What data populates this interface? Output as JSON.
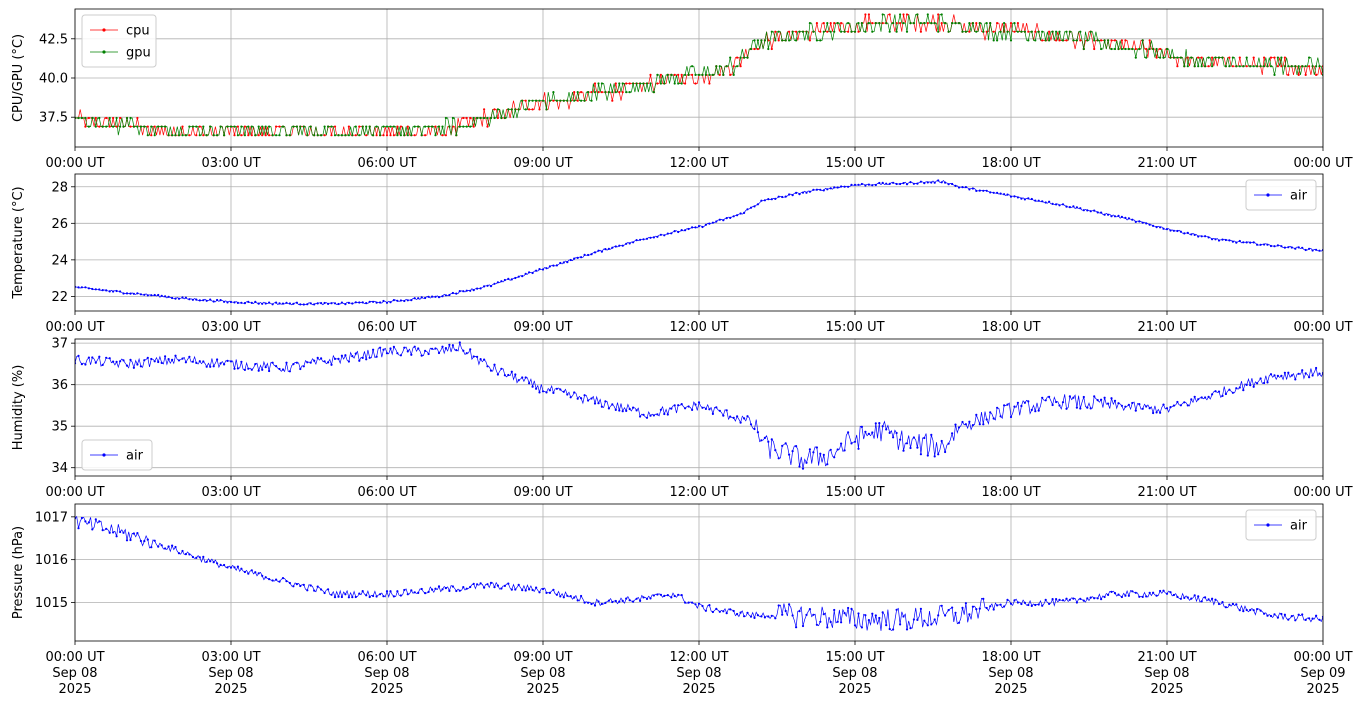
{
  "chart_data": [
    {
      "type": "line",
      "ylabel": "CPU/GPU (°C)",
      "xlabel": "",
      "ylim": [
        35.6,
        44.4
      ],
      "yticks": [
        37.5,
        40.0,
        42.5
      ],
      "ytick_labels": [
        "37.5",
        "40.0",
        "42.5"
      ],
      "xlim_hours": [
        0,
        24
      ],
      "xtick_labels": [
        "00:00 UT",
        "03:00 UT",
        "06:00 UT",
        "09:00 UT",
        "12:00 UT",
        "15:00 UT",
        "18:00 UT",
        "21:00 UT",
        "00:00 UT"
      ],
      "grid": true,
      "legend": "upper left",
      "series": [
        {
          "name": "cpu",
          "color": "#ff0000",
          "points": [
            [
              0,
              37.5
            ],
            [
              0.5,
              37.0
            ],
            [
              1,
              37.0
            ],
            [
              1.5,
              36.5
            ],
            [
              2,
              36.5
            ],
            [
              3,
              36.5
            ],
            [
              4,
              36.5
            ],
            [
              5,
              36.5
            ],
            [
              6,
              36.5
            ],
            [
              7,
              36.5
            ],
            [
              7.5,
              37.0
            ],
            [
              8,
              37.5
            ],
            [
              8.5,
              38.0
            ],
            [
              9,
              38.5
            ],
            [
              9.5,
              38.5
            ],
            [
              10,
              39.0
            ],
            [
              10.5,
              39.2
            ],
            [
              11,
              39.5
            ],
            [
              11.5,
              40.0
            ],
            [
              12,
              40.0
            ],
            [
              12.5,
              40.5
            ],
            [
              12.8,
              41.0
            ],
            [
              13,
              42.0
            ],
            [
              13.5,
              42.5
            ],
            [
              14,
              42.8
            ],
            [
              14.5,
              43.0
            ],
            [
              15,
              43.3
            ],
            [
              15.5,
              43.5
            ],
            [
              16,
              43.5
            ],
            [
              16.5,
              43.5
            ],
            [
              17,
              43.3
            ],
            [
              17.5,
              43.0
            ],
            [
              18,
              43.0
            ],
            [
              18.5,
              42.8
            ],
            [
              19,
              42.5
            ],
            [
              19.5,
              42.3
            ],
            [
              20,
              42.0
            ],
            [
              20.5,
              41.8
            ],
            [
              21,
              41.5
            ],
            [
              21.5,
              41.0
            ],
            [
              22,
              41.0
            ],
            [
              22.5,
              40.7
            ],
            [
              23,
              40.7
            ],
            [
              23.5,
              40.7
            ],
            [
              24,
              40.5
            ]
          ]
        },
        {
          "name": "gpu",
          "color": "#008000",
          "points": [
            [
              0,
              37.5
            ],
            [
              0.5,
              37.0
            ],
            [
              1,
              37.0
            ],
            [
              1.5,
              36.7
            ],
            [
              2,
              36.7
            ],
            [
              3,
              36.7
            ],
            [
              4,
              36.5
            ],
            [
              5,
              36.5
            ],
            [
              6,
              36.7
            ],
            [
              7,
              36.7
            ],
            [
              7.5,
              37.0
            ],
            [
              8,
              37.5
            ],
            [
              8.5,
              38.0
            ],
            [
              9,
              38.5
            ],
            [
              9.5,
              38.5
            ],
            [
              10,
              39.0
            ],
            [
              10.5,
              39.2
            ],
            [
              11,
              39.5
            ],
            [
              11.5,
              40.0
            ],
            [
              12,
              40.2
            ],
            [
              12.5,
              40.5
            ],
            [
              12.8,
              41.0
            ],
            [
              13,
              42.0
            ],
            [
              13.5,
              42.5
            ],
            [
              14,
              42.8
            ],
            [
              14.5,
              43.0
            ],
            [
              15,
              43.3
            ],
            [
              15.5,
              43.5
            ],
            [
              16,
              43.5
            ],
            [
              16.5,
              43.5
            ],
            [
              17,
              43.3
            ],
            [
              17.5,
              43.0
            ],
            [
              18,
              43.0
            ],
            [
              18.5,
              42.8
            ],
            [
              19,
              42.5
            ],
            [
              19.5,
              42.3
            ],
            [
              20,
              42.0
            ],
            [
              20.5,
              41.8
            ],
            [
              21,
              41.5
            ],
            [
              21.5,
              41.0
            ],
            [
              22,
              41.0
            ],
            [
              22.5,
              40.7
            ],
            [
              23,
              40.7
            ],
            [
              23.5,
              40.7
            ],
            [
              24,
              40.7
            ]
          ]
        }
      ]
    },
    {
      "type": "line",
      "ylabel": "Temperature (°C)",
      "xlabel": "",
      "ylim": [
        21.2,
        28.7
      ],
      "yticks": [
        22,
        24,
        26,
        28
      ],
      "ytick_labels": [
        "22",
        "24",
        "26",
        "28"
      ],
      "xlim_hours": [
        0,
        24
      ],
      "xtick_labels": [
        "00:00 UT",
        "03:00 UT",
        "06:00 UT",
        "09:00 UT",
        "12:00 UT",
        "15:00 UT",
        "18:00 UT",
        "21:00 UT",
        "00:00 UT"
      ],
      "grid": true,
      "legend": "upper right",
      "series": [
        {
          "name": "air",
          "color": "#0000ff",
          "points": [
            [
              0,
              22.5
            ],
            [
              1,
              22.2
            ],
            [
              2,
              21.9
            ],
            [
              3,
              21.7
            ],
            [
              4,
              21.6
            ],
            [
              5,
              21.6
            ],
            [
              6,
              21.7
            ],
            [
              7,
              22.0
            ],
            [
              8,
              22.6
            ],
            [
              9,
              23.5
            ],
            [
              10,
              24.4
            ],
            [
              11,
              25.2
            ],
            [
              12,
              25.8
            ],
            [
              12.8,
              26.5
            ],
            [
              13.2,
              27.2
            ],
            [
              14,
              27.7
            ],
            [
              15,
              28.1
            ],
            [
              16,
              28.2
            ],
            [
              16.7,
              28.3
            ],
            [
              17,
              28.0
            ],
            [
              18,
              27.5
            ],
            [
              19,
              27.0
            ],
            [
              20,
              26.4
            ],
            [
              21,
              25.7
            ],
            [
              22,
              25.1
            ],
            [
              23,
              24.8
            ],
            [
              24,
              24.5
            ]
          ]
        }
      ]
    },
    {
      "type": "line",
      "ylabel": "Humidity (%)",
      "xlabel": "",
      "ylim": [
        33.8,
        37.1
      ],
      "yticks": [
        34,
        35,
        36,
        37
      ],
      "ytick_labels": [
        "34",
        "35",
        "36",
        "37"
      ],
      "xlim_hours": [
        0,
        24
      ],
      "xtick_labels": [
        "00:00 UT",
        "03:00 UT",
        "06:00 UT",
        "09:00 UT",
        "12:00 UT",
        "15:00 UT",
        "18:00 UT",
        "21:00 UT",
        "00:00 UT"
      ],
      "grid": true,
      "legend": "lower left",
      "series": [
        {
          "name": "air",
          "color": "#0000ff",
          "points": [
            [
              0,
              36.6
            ],
            [
              1,
              36.5
            ],
            [
              2,
              36.6
            ],
            [
              3,
              36.5
            ],
            [
              4,
              36.4
            ],
            [
              5,
              36.6
            ],
            [
              6,
              36.8
            ],
            [
              7,
              36.8
            ],
            [
              7.4,
              36.9
            ],
            [
              8,
              36.4
            ],
            [
              9,
              35.9
            ],
            [
              10,
              35.6
            ],
            [
              11,
              35.3
            ],
            [
              11.5,
              35.4
            ],
            [
              12,
              35.5
            ],
            [
              12.5,
              35.3
            ],
            [
              13,
              35.1
            ],
            [
              13.3,
              34.5
            ],
            [
              14,
              34.2
            ],
            [
              14.5,
              34.3
            ],
            [
              15,
              34.7
            ],
            [
              15.5,
              34.9
            ],
            [
              16,
              34.6
            ],
            [
              16.7,
              34.5
            ],
            [
              17,
              35.0
            ],
            [
              17.5,
              35.2
            ],
            [
              18,
              35.4
            ],
            [
              19,
              35.6
            ],
            [
              20,
              35.5
            ],
            [
              21,
              35.4
            ],
            [
              22,
              35.8
            ],
            [
              23,
              36.2
            ],
            [
              24,
              36.3
            ]
          ]
        }
      ]
    },
    {
      "type": "line",
      "ylabel": "Pressure (hPa)",
      "xlabel": "",
      "ylim": [
        1014.1,
        1017.3
      ],
      "yticks": [
        1015,
        1016,
        1017
      ],
      "ytick_labels": [
        "1015",
        "1016",
        "1017"
      ],
      "xlim_hours": [
        0,
        24
      ],
      "xtick_labels": [
        "00:00 UT\nSep 08\n2025",
        "03:00 UT\nSep 08\n2025",
        "06:00 UT\nSep 08\n2025",
        "09:00 UT\nSep 08\n2025",
        "12:00 UT\nSep 08\n2025",
        "15:00 UT\nSep 08\n2025",
        "18:00 UT\nSep 08\n2025",
        "21:00 UT\nSep 08\n2025",
        "00:00 UT\nSep 09\n2025"
      ],
      "grid": true,
      "legend": "upper right",
      "series": [
        {
          "name": "air",
          "color": "#0000ff",
          "points": [
            [
              0,
              1016.9
            ],
            [
              1,
              1016.6
            ],
            [
              2,
              1016.2
            ],
            [
              3,
              1015.8
            ],
            [
              4,
              1015.5
            ],
            [
              5,
              1015.2
            ],
            [
              6,
              1015.2
            ],
            [
              7,
              1015.3
            ],
            [
              8,
              1015.4
            ],
            [
              9,
              1015.3
            ],
            [
              10,
              1015.0
            ],
            [
              11,
              1015.1
            ],
            [
              11.5,
              1015.2
            ],
            [
              12,
              1014.9
            ],
            [
              13,
              1014.7
            ],
            [
              14,
              1014.7
            ],
            [
              15,
              1014.6
            ],
            [
              16,
              1014.6
            ],
            [
              17,
              1014.7
            ],
            [
              18,
              1015.0
            ],
            [
              19,
              1015.0
            ],
            [
              20,
              1015.2
            ],
            [
              21,
              1015.2
            ],
            [
              22,
              1015.0
            ],
            [
              23,
              1014.7
            ],
            [
              24,
              1014.6
            ]
          ]
        }
      ]
    }
  ]
}
